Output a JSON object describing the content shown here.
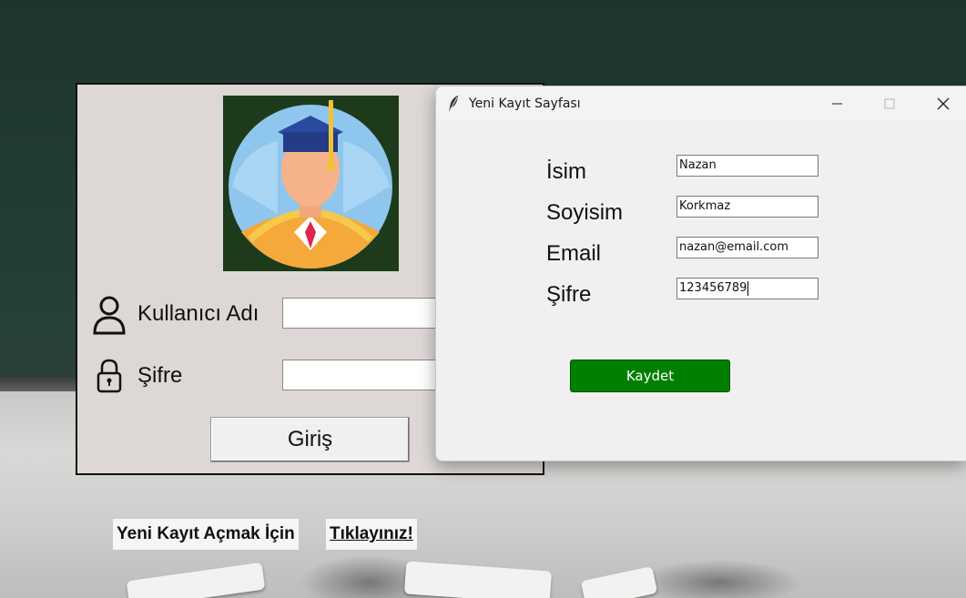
{
  "login": {
    "username_label": "Kullanıcı Adı",
    "password_label": "Şifre",
    "username_value": "",
    "password_value": "",
    "login_button": "Giriş",
    "avatar_icon": "graduate-avatar-icon",
    "user_icon": "user-icon",
    "lock_icon": "lock-icon"
  },
  "register_link": {
    "text": "Yeni Kayıt Açmak İçin",
    "link": "Tıklayınız!"
  },
  "dialog": {
    "title": "Yeni Kayıt Sayfası",
    "title_icon": "feather-icon",
    "fields": [
      {
        "label": "İsim",
        "value": "Nazan"
      },
      {
        "label": "Soyisim",
        "value": "Korkmaz"
      },
      {
        "label": "Email",
        "value": "nazan@email.com"
      },
      {
        "label": "Şifre",
        "value": "123456789"
      }
    ],
    "save_button": "Kaydet",
    "colors": {
      "save_button": "#008000"
    }
  }
}
